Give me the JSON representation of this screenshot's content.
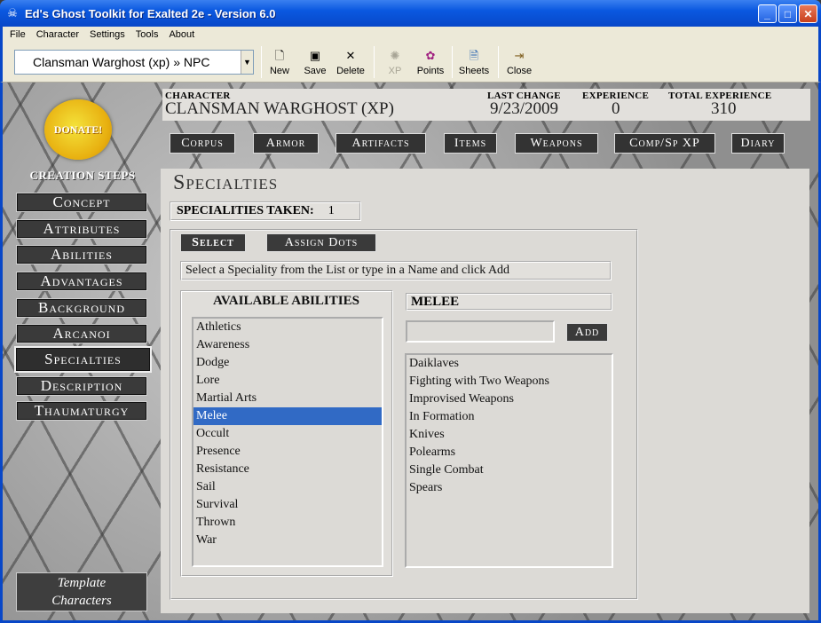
{
  "window": {
    "title": "Ed's Ghost Toolkit for Exalted 2e - Version 6.0",
    "buttons": {
      "minimize": "_",
      "maximize": "□",
      "close": "✕"
    }
  },
  "menu": [
    "File",
    "Character",
    "Settings",
    "Tools",
    "About"
  ],
  "toolbar": {
    "character_select": "Clansman Warghost (xp) » NPC",
    "buttons": [
      {
        "label": "New",
        "icon": "new-document-icon",
        "enabled": true
      },
      {
        "label": "Save",
        "icon": "floppy-disk-icon",
        "enabled": true
      },
      {
        "label": "Delete",
        "icon": "delete-x-icon",
        "enabled": true
      },
      {
        "label": "XP",
        "icon": "xp-icon",
        "enabled": false
      },
      {
        "label": "Points",
        "icon": "points-icon",
        "enabled": true
      },
      {
        "label": "Sheets",
        "icon": "sheets-icon",
        "enabled": true
      },
      {
        "label": "Close",
        "icon": "exit-door-icon",
        "enabled": true
      }
    ]
  },
  "sidebar": {
    "donate": "DONATE!",
    "heading": "CREATION STEPS",
    "steps": [
      "Concept",
      "Attributes",
      "Abilities",
      "Advantages",
      "Background",
      "Arcanoi",
      "Specialties",
      "Description",
      "Thaumaturgy"
    ],
    "active_step": "Specialties",
    "template_line1": "Template",
    "template_line2": "Characters"
  },
  "character": {
    "label_character": "CHARACTER",
    "name": "CLANSMAN WARGHOST (XP)",
    "label_last_change": "LAST CHANGE",
    "last_change": "9/23/2009",
    "label_experience": "EXPERIENCE",
    "experience": "0",
    "label_total_experience": "TOTAL EXPERIENCE",
    "total_experience": "310"
  },
  "tabs": [
    "Corpus",
    "Armor",
    "Artifacts",
    "Items",
    "Weapons",
    "Comp/Sp XP",
    "Diary"
  ],
  "main": {
    "title": "Specialties",
    "taken_label": "SPECIALITIES TAKEN:",
    "taken_value": "1",
    "mode_buttons": [
      "Select",
      "Assign Dots"
    ],
    "hint": "Select a Speciality from the List or type in a Name and click Add",
    "abilities_heading": "AVAILABLE ABILITIES",
    "abilities": [
      "Athletics",
      "Awareness",
      "Dodge",
      "Lore",
      "Martial Arts",
      "Melee",
      "Occult",
      "Presence",
      "Resistance",
      "Sail",
      "Survival",
      "Thrown",
      "War"
    ],
    "selected_ability": "Melee",
    "selected_ability_heading": "MELEE",
    "add_label": "Add",
    "specialties": [
      "Daiklaves",
      "Fighting with Two Weapons",
      "Improvised Weapons",
      "In Formation",
      "Knives",
      "Polearms",
      "Single Combat",
      "Spears"
    ]
  }
}
